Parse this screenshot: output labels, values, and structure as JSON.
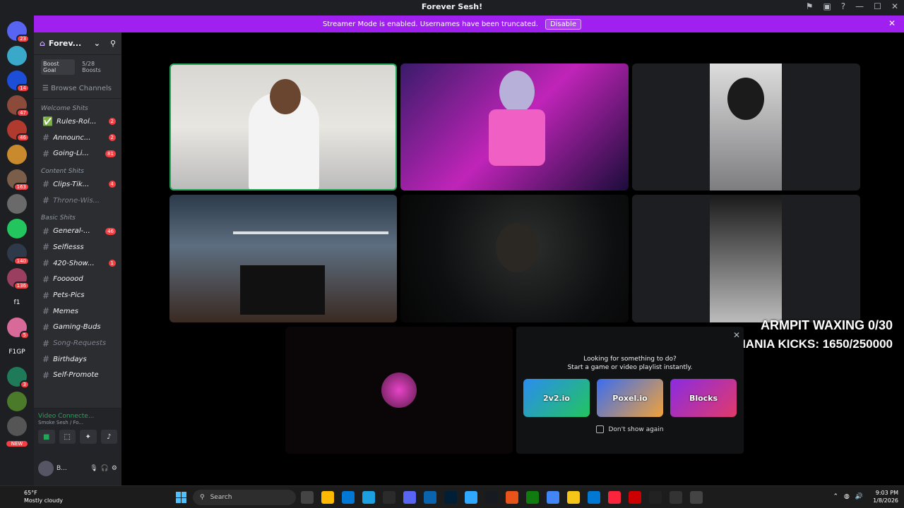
{
  "window": {
    "title": "Forever Sesh!"
  },
  "banner": {
    "text": "Streamer Mode is enabled. Usernames have been truncated.",
    "button": "Disable"
  },
  "servers": [
    {
      "label": "",
      "badge": "23",
      "color": "#5865f2"
    },
    {
      "label": "",
      "badge": "",
      "color": "#3aa8c9"
    },
    {
      "label": "",
      "badge": "14",
      "color": "#1d4ed8"
    },
    {
      "label": "",
      "badge": "47",
      "color": "#8b4a3a"
    },
    {
      "label": "",
      "badge": "46",
      "color": "#b03a2e"
    },
    {
      "label": "",
      "badge": "",
      "color": "#c98a2e"
    },
    {
      "label": "",
      "badge": "163",
      "color": "#7a5e4a"
    },
    {
      "label": "",
      "badge": "",
      "color": "#6a6a6a"
    },
    {
      "label": "",
      "badge": "",
      "color": "#22c55e"
    },
    {
      "label": "",
      "badge": "140",
      "color": "#2e3a4a"
    },
    {
      "label": "",
      "badge": "136",
      "color": "#9a3f5f"
    },
    {
      "label": "f1",
      "badge": "",
      "color": "#1e1f22"
    },
    {
      "label": "",
      "badge": "5",
      "color": "#d86a9a"
    },
    {
      "label": "F1GP",
      "badge": "",
      "color": "#1e1f22"
    },
    {
      "label": "",
      "badge": "3",
      "color": "#1f7a5a"
    },
    {
      "label": "",
      "badge": "",
      "color": "#4a7a2a"
    },
    {
      "label": "",
      "badge": "",
      "color": "#555"
    }
  ],
  "servers_new_label": "NEW",
  "guild": {
    "name": "Forev...",
    "boost_goal": "Boost Goal",
    "boosts": "5/28 Boosts",
    "browse": "Browse Channels"
  },
  "categories": [
    {
      "name": "Welcome Shits",
      "channels": [
        {
          "name": "Rules-Rol...",
          "count": "2",
          "icon": "✅"
        },
        {
          "name": "Announc...",
          "count": "2",
          "icon": "#"
        },
        {
          "name": "Going-Li...",
          "count": "81",
          "icon": "#"
        }
      ]
    },
    {
      "name": "Content Shits",
      "channels": [
        {
          "name": "Clips-Tik...",
          "count": "4",
          "icon": "#"
        },
        {
          "name": "Throne-Wis...",
          "count": "",
          "icon": "#",
          "muted": true
        }
      ]
    },
    {
      "name": "Basic Shits",
      "channels": [
        {
          "name": "General-...",
          "count": "46",
          "icon": "#"
        },
        {
          "name": "Selfiesss",
          "count": "",
          "icon": "#"
        },
        {
          "name": "420-Show...",
          "count": "1",
          "icon": "#"
        },
        {
          "name": "Foooood",
          "count": "",
          "icon": "#"
        },
        {
          "name": "Pets-Pics",
          "count": "",
          "icon": "#"
        },
        {
          "name": "Memes",
          "count": "",
          "icon": "#"
        },
        {
          "name": "Gaming-Buds",
          "count": "",
          "icon": "#"
        },
        {
          "name": "Song-Requests",
          "count": "",
          "icon": "#",
          "muted": true
        },
        {
          "name": "Birthdays",
          "count": "",
          "icon": "#"
        },
        {
          "name": "Self-Promote",
          "count": "",
          "icon": "#"
        }
      ]
    }
  ],
  "voice": {
    "status": "Video Connecte...",
    "channel": "Smoke Sesh / Fo..."
  },
  "user": {
    "name": "B..."
  },
  "overlay": {
    "line1": "ARMPIT WAXING 0/30",
    "line2": "CHOJ-MANIA KICKS: 1650/250000"
  },
  "activity": {
    "line1": "Looking for something to do?",
    "line2": "Start a game or video playlist instantly.",
    "games": [
      "2v2.io",
      "Poxel.io",
      "Blocks"
    ],
    "dont_show": "Don't show again"
  },
  "taskbar": {
    "temp": "65°F",
    "weather": "Mostly cloudy",
    "search_placeholder": "Search",
    "time": "9:03 PM",
    "date": "1/8/2026"
  }
}
